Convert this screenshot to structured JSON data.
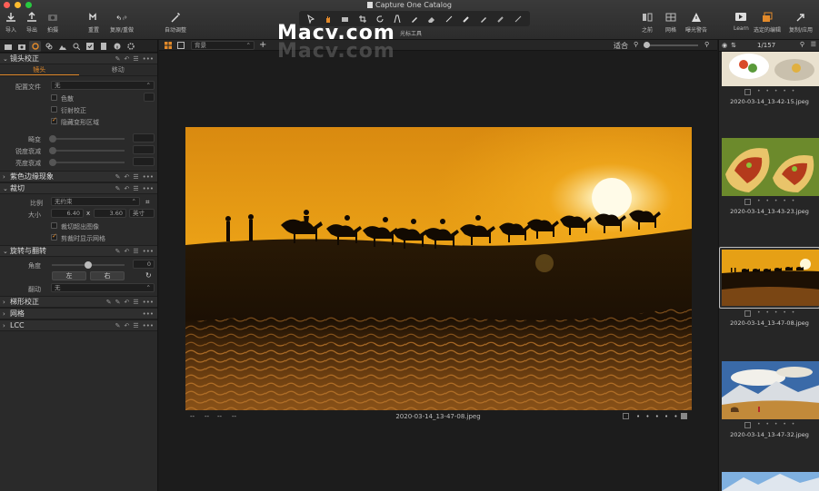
{
  "window": {
    "title": "Capture One Catalog"
  },
  "watermark": "Macv.com",
  "toolbar": {
    "import": "导入",
    "export": "导出",
    "capture": "拍摄",
    "undo": "重置",
    "redo": "复原/重做",
    "auto": "自动调整",
    "cursor_tools": "光标工具",
    "before": "之前",
    "grid": "网格",
    "exposure_warning": "曝光警告",
    "learn": "Learn",
    "edit_selected": "选定的编辑",
    "copy_apply": "复制/应用"
  },
  "left": {
    "lens": {
      "title": "镜头校正",
      "tab_lens": "镜头",
      "tab_movement": "移动",
      "profile_label": "配置文件",
      "profile_value": "无",
      "dispersion": "色散",
      "diffraction": "衍射校正",
      "hide_distorted": "隐藏变形区域",
      "distortion": "畸变",
      "sharpness_falloff": "锐度衰减",
      "light_falloff": "亮度衰减"
    },
    "purple_fringing": "紫色边缘现象",
    "crop": {
      "title": "裁切",
      "ratio_label": "比例",
      "ratio_value": "无约束",
      "size_label": "大小",
      "width": "6.40",
      "x": "x",
      "height": "3.60",
      "unit": "英寸",
      "crop_outside": "裁切超出图像",
      "show_mask": "剪裁时显示网格"
    },
    "rotation": {
      "title": "旋转与翻转",
      "angle_label": "角度",
      "angle_value": "0",
      "left": "左",
      "right": "右",
      "flip_label": "翻动",
      "flip_value": "无"
    },
    "keystone": "梯形校正",
    "grid": "网格",
    "lcc": "LCC"
  },
  "center": {
    "background_select": "背景",
    "fit": "适合",
    "filename": "2020-03-14_13-47-08.jpeg",
    "bottom_left": [
      "--",
      "--",
      "--",
      "--"
    ]
  },
  "browser": {
    "count": "1/157",
    "thumbs": [
      {
        "name": "2020-03-14_13-42-15.jpeg",
        "selected": false
      },
      {
        "name": "2020-03-14_13-43-23.jpeg",
        "selected": false
      },
      {
        "name": "2020-03-14_13-47-08.jpeg",
        "selected": true
      },
      {
        "name": "2020-03-14_13-47-32.jpeg",
        "selected": false
      }
    ],
    "dots": "• • • • •"
  },
  "colors": {
    "accent": "#e38a2a",
    "close": "#ff5f57",
    "min": "#febc2e",
    "max": "#28c840"
  }
}
